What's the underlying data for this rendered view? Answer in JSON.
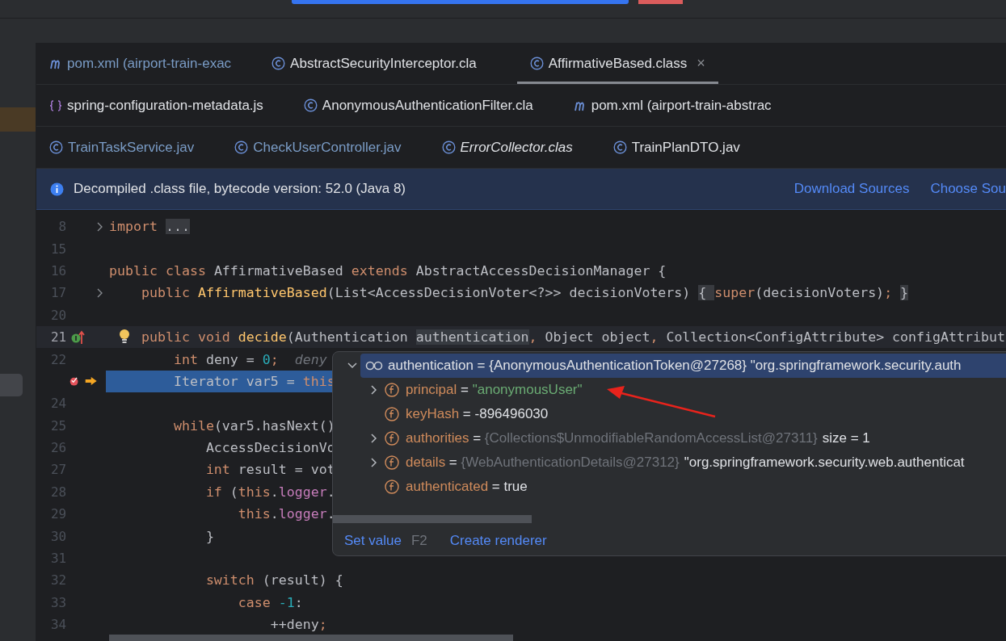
{
  "tab_rows": [
    [
      {
        "kind": "maven",
        "label": "pom.xml (airport-train-exac",
        "selected": false,
        "modified": true,
        "preview": false
      },
      {
        "kind": "class",
        "label": "AbstractSecurityInterceptor.cla",
        "selected": false,
        "modified": false,
        "preview": false
      },
      {
        "kind": "class",
        "label": "AffirmativeBased.class",
        "selected": true,
        "modified": false,
        "preview": false,
        "close": "×"
      }
    ],
    [
      {
        "kind": "json",
        "label": "spring-configuration-metadata.js",
        "selected": false,
        "modified": false,
        "preview": false
      },
      {
        "kind": "class",
        "label": "AnonymousAuthenticationFilter.cla",
        "selected": false,
        "modified": false,
        "preview": false
      },
      {
        "kind": "maven",
        "label": "pom.xml (airport-train-abstrac",
        "selected": false,
        "modified": false,
        "preview": false
      }
    ],
    [
      {
        "kind": "class",
        "label": "TrainTaskService.jav",
        "selected": false,
        "modified": true,
        "preview": false
      },
      {
        "kind": "class",
        "label": "CheckUserController.jav",
        "selected": false,
        "modified": true,
        "preview": false
      },
      {
        "kind": "class",
        "label": "ErrorCollector.clas",
        "selected": false,
        "modified": false,
        "preview": true
      },
      {
        "kind": "class",
        "label": "TrainPlanDTO.jav",
        "selected": false,
        "modified": false,
        "preview": false
      }
    ]
  ],
  "banner": {
    "message": "Decompiled .class file, bytecode version: 52.0 (Java 8)",
    "links": [
      "Download Sources",
      "Choose Sou"
    ]
  },
  "code_lines": [
    {
      "number": "8",
      "fold": true,
      "implements": false,
      "breakpoint": false,
      "execution": false,
      "current": false,
      "tokens": [
        {
          "kind": "kw",
          "text": "import "
        },
        {
          "kind": "folded",
          "text": "..."
        }
      ]
    },
    {
      "number": "15",
      "fold": false,
      "implements": false,
      "breakpoint": false,
      "execution": false,
      "current": false
    },
    {
      "number": "16",
      "fold": false,
      "implements": false,
      "breakpoint": false,
      "execution": false,
      "current": false,
      "tokens": [
        {
          "kind": "kw",
          "text": "public class "
        },
        {
          "kind": "plain",
          "text": "AffirmativeBased "
        },
        {
          "kind": "kw",
          "text": "extends "
        },
        {
          "kind": "plain",
          "text": "AbstractAccessDecisionManager {"
        }
      ]
    },
    {
      "number": "17",
      "fold": true,
      "implements": false,
      "breakpoint": false,
      "execution": false,
      "current": false,
      "tokens": [
        {
          "kind": "kw",
          "text": "    public "
        },
        {
          "kind": "fn",
          "text": "AffirmativeBased"
        },
        {
          "kind": "plain",
          "text": "(List<AccessDecisionVoter<?>> decisionVoters) "
        },
        {
          "kind": "folded",
          "text": "{ "
        },
        {
          "kind": "kw",
          "text": "super"
        },
        {
          "kind": "plain",
          "text": "(decisionVoters)"
        },
        {
          "kind": "kw",
          "text": "; "
        },
        {
          "kind": "folded",
          "text": "}"
        }
      ]
    },
    {
      "number": "20",
      "fold": false,
      "implements": false,
      "breakpoint": false,
      "execution": false,
      "current": false
    },
    {
      "number": "21",
      "fold": false,
      "implements": true,
      "breakpoint": false,
      "execution": false,
      "current": true,
      "tokens": [
        {
          "kind": "kw",
          "text": "    public void "
        },
        {
          "kind": "fn",
          "text": "decide"
        },
        {
          "kind": "plain",
          "text": "(Authentication "
        },
        {
          "kind": "usage",
          "text": "authentication"
        },
        {
          "kind": "kw",
          "text": ", "
        },
        {
          "kind": "plain",
          "text": "Object object"
        },
        {
          "kind": "kw",
          "text": ", "
        },
        {
          "kind": "plain",
          "text": "Collection<ConfigAttribute> configAttribut"
        }
      ]
    },
    {
      "number": "22",
      "fold": false,
      "implements": false,
      "breakpoint": false,
      "execution": false,
      "current": false,
      "tokens": [
        {
          "kind": "kw",
          "text": "        int "
        },
        {
          "kind": "plain",
          "text": "deny = "
        },
        {
          "kind": "num",
          "text": "0"
        },
        {
          "kind": "kw",
          "text": ";  "
        },
        {
          "kind": "hint",
          "text": "deny"
        }
      ]
    },
    {
      "fold": false,
      "implements": false,
      "breakpoint": true,
      "execution": true,
      "current": false,
      "tokens": [
        {
          "kind": "plain",
          "text": "        Iterator var5 = "
        },
        {
          "kind": "kw",
          "text": "this"
        }
      ]
    },
    {
      "number": "24",
      "fold": false,
      "implements": false,
      "breakpoint": false,
      "execution": false,
      "current": false
    },
    {
      "number": "25",
      "fold": false,
      "implements": false,
      "breakpoint": false,
      "execution": false,
      "current": false,
      "tokens": [
        {
          "kind": "kw",
          "text": "        while"
        },
        {
          "kind": "plain",
          "text": "(var5.hasNext()"
        }
      ]
    },
    {
      "number": "26",
      "fold": false,
      "implements": false,
      "breakpoint": false,
      "execution": false,
      "current": false,
      "tokens": [
        {
          "kind": "plain",
          "text": "            AccessDecisionVo"
        }
      ]
    },
    {
      "number": "27",
      "fold": false,
      "implements": false,
      "breakpoint": false,
      "execution": false,
      "current": false,
      "tokens": [
        {
          "kind": "kw",
          "text": "            int "
        },
        {
          "kind": "plain",
          "text": "result = vot"
        }
      ]
    },
    {
      "number": "28",
      "fold": false,
      "implements": false,
      "breakpoint": false,
      "execution": false,
      "current": false,
      "tokens": [
        {
          "kind": "kw",
          "text": "            if "
        },
        {
          "kind": "plain",
          "text": "("
        },
        {
          "kind": "kw",
          "text": "this"
        },
        {
          "kind": "plain",
          "text": "."
        },
        {
          "kind": "field",
          "text": "logger"
        },
        {
          "kind": "plain",
          "text": "."
        }
      ]
    },
    {
      "number": "29",
      "fold": false,
      "implements": false,
      "breakpoint": false,
      "execution": false,
      "current": false,
      "tokens": [
        {
          "kind": "kw",
          "text": "                this"
        },
        {
          "kind": "plain",
          "text": "."
        },
        {
          "kind": "field",
          "text": "logger"
        },
        {
          "kind": "plain",
          "text": "."
        }
      ]
    },
    {
      "number": "30",
      "fold": false,
      "implements": false,
      "breakpoint": false,
      "execution": false,
      "current": false,
      "tokens": [
        {
          "kind": "plain",
          "text": "            }"
        }
      ]
    },
    {
      "number": "31",
      "fold": false,
      "implements": false,
      "breakpoint": false,
      "execution": false,
      "current": false
    },
    {
      "number": "32",
      "fold": false,
      "implements": false,
      "breakpoint": false,
      "execution": false,
      "current": false,
      "tokens": [
        {
          "kind": "kw",
          "text": "            switch "
        },
        {
          "kind": "plain",
          "text": "(result) {"
        }
      ]
    },
    {
      "number": "33",
      "fold": false,
      "implements": false,
      "breakpoint": false,
      "execution": false,
      "current": false,
      "tokens": [
        {
          "kind": "kw",
          "text": "                case "
        },
        {
          "kind": "num",
          "text": "-1"
        },
        {
          "kind": "plain",
          "text": ":"
        }
      ]
    },
    {
      "number": "34",
      "fold": false,
      "implements": false,
      "breakpoint": false,
      "execution": false,
      "current": false,
      "tokens": [
        {
          "kind": "plain",
          "text": "                    ++deny"
        },
        {
          "kind": "kw",
          "text": ";"
        }
      ]
    }
  ],
  "debug_popup": {
    "root": {
      "expanded": true,
      "selected": true,
      "name": "authentication",
      "sep": "=",
      "value": "{AnonymousAuthenticationToken@27268}",
      "extra": "\"org.springframework.security.auth"
    },
    "fields": [
      {
        "expandable": true,
        "name": "principal",
        "sep": "=",
        "value": "\"anonymousUser\"",
        "kind": "string"
      },
      {
        "expandable": false,
        "name": "keyHash",
        "sep": "=",
        "value": "-896496030",
        "kind": "plain"
      },
      {
        "expandable": true,
        "name": "authorities",
        "sep": "=",
        "value": "{Collections$UnmodifiableRandomAccessList@27311}",
        "kind": "ref",
        "extra": "size = 1"
      },
      {
        "expandable": true,
        "name": "details",
        "sep": "=",
        "value": "{WebAuthenticationDetails@27312}",
        "kind": "ref",
        "extra": "\"org.springframework.security.web.authenticat"
      },
      {
        "expandable": false,
        "name": "authenticated",
        "sep": "=",
        "value": "true",
        "kind": "plain"
      }
    ],
    "actions": [
      {
        "label": "Set value",
        "shortcut": "F2"
      },
      {
        "label": "Create renderer"
      }
    ]
  }
}
